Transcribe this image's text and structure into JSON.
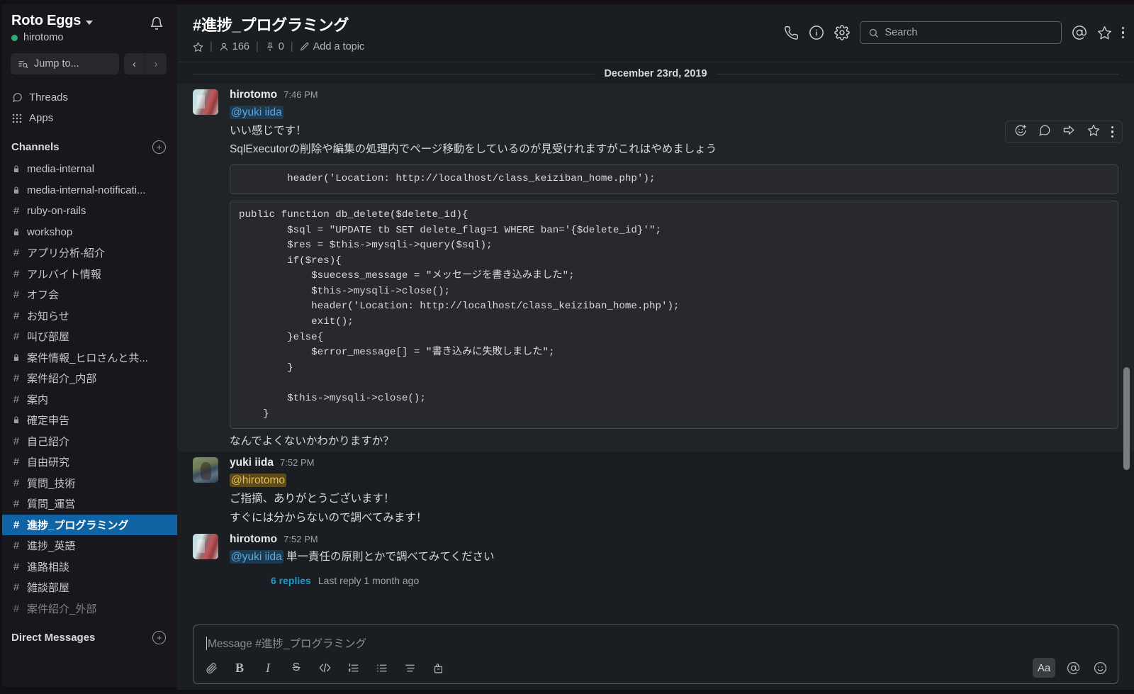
{
  "sidebar": {
    "workspace_name": "Roto Eggs",
    "username": "hirotomo",
    "jump_to_placeholder": "Jump to...",
    "nav_items": [
      {
        "label": "Threads",
        "icon": "threads-icon"
      },
      {
        "label": "Apps",
        "icon": "apps-grid-icon"
      }
    ],
    "channels_heading": "Channels",
    "channels": [
      {
        "name": "media-internal",
        "sym": "lock",
        "state": "normal"
      },
      {
        "name": "media-internal-notificati...",
        "sym": "lock",
        "state": "normal"
      },
      {
        "name": "ruby-on-rails",
        "sym": "hash",
        "state": "normal"
      },
      {
        "name": "workshop",
        "sym": "lock",
        "state": "normal"
      },
      {
        "name": "アプリ分析-紹介",
        "sym": "hash",
        "state": "normal"
      },
      {
        "name": "アルバイト情報",
        "sym": "hash",
        "state": "normal"
      },
      {
        "name": "オフ会",
        "sym": "hash",
        "state": "normal"
      },
      {
        "name": "お知らせ",
        "sym": "hash",
        "state": "normal"
      },
      {
        "name": "叫び部屋",
        "sym": "hash",
        "state": "normal"
      },
      {
        "name": "案件情報_ヒロさんと共...",
        "sym": "lock",
        "state": "normal"
      },
      {
        "name": "案件紹介_内部",
        "sym": "hash",
        "state": "normal"
      },
      {
        "name": "案内",
        "sym": "hash",
        "state": "normal"
      },
      {
        "name": "確定申告",
        "sym": "lock",
        "state": "normal"
      },
      {
        "name": "自己紹介",
        "sym": "hash",
        "state": "normal"
      },
      {
        "name": "自由研究",
        "sym": "hash",
        "state": "normal"
      },
      {
        "name": "質問_技術",
        "sym": "hash",
        "state": "normal"
      },
      {
        "name": "質問_運営",
        "sym": "hash",
        "state": "normal"
      },
      {
        "name": "進捗_プログラミング",
        "sym": "hash",
        "state": "active"
      },
      {
        "name": "進捗_英語",
        "sym": "hash",
        "state": "normal"
      },
      {
        "name": "進路相談",
        "sym": "hash",
        "state": "normal"
      },
      {
        "name": "雑談部屋",
        "sym": "hash",
        "state": "normal"
      },
      {
        "name": "案件紹介_外部",
        "sym": "hash",
        "state": "muted"
      }
    ],
    "dm_heading": "Direct Messages"
  },
  "header": {
    "channel_title": "#進捗_プログラミング",
    "member_count": "166",
    "pin_count": "0",
    "add_topic": "Add a topic",
    "search_placeholder": "Search",
    "icons": [
      "phone-icon",
      "info-icon",
      "gear-icon",
      "mentions-icon",
      "star-icon",
      "kebab-menu-icon"
    ]
  },
  "messages": {
    "date_divider": "December 23rd, 2019",
    "items": [
      {
        "author": "hirotomo",
        "time": "7:46 PM",
        "avatar": "hiro",
        "mention": "@yuki iida",
        "mention_type": "other",
        "lines": [
          "いい感じです！",
          "SqlExecutorの削除や編集の処理内でページ移動をしているのが見受けれますがこれはやめましょう"
        ],
        "code_blocks": [
          "        header('Location: http://localhost/class_keiziban_home.php');",
          "public function db_delete($delete_id){\n        $sql = \"UPDATE tb SET delete_flag=1 WHERE ban='{$delete_id}'\";\n        $res = $this->mysqli->query($sql);\n        if($res){\n            $suecess_message = \"メッセージを書き込みました\";\n            $this->mysqli->close();\n            header('Location: http://localhost/class_keiziban_home.php');\n            exit();\n        }else{\n            $error_message[] = \"書き込みに失敗しました\";\n        }\n\n        $this->mysqli->close();\n    }"
        ],
        "trailing_lines": [
          "なんでよくないかわかりますか？"
        ]
      },
      {
        "author": "yuki iida",
        "time": "7:52 PM",
        "avatar": "yuki",
        "mention": "@hirotomo",
        "mention_type": "self",
        "lines": [
          "ご指摘、ありがとうございます！",
          "すぐには分からないので調べてみます！"
        ],
        "code_blocks": [],
        "trailing_lines": []
      },
      {
        "author": "hirotomo",
        "time": "7:52 PM",
        "avatar": "hiro",
        "mention": "@yuki iida",
        "mention_type": "other",
        "inline_text": " 単一責任の原則とかで調べてみてください",
        "lines": [],
        "code_blocks": [],
        "trailing_lines": [],
        "thread": {
          "replies_label": "6 replies",
          "last_reply": "Last reply 1 month ago"
        }
      }
    ]
  },
  "composer": {
    "placeholder": "Message #進捗_プログラミング",
    "tools_left": [
      "attach-icon",
      "bold-icon",
      "italic-icon",
      "strikethrough-icon",
      "code-icon",
      "ordered-list-icon",
      "bulleted-list-icon",
      "blockquote-icon",
      "snippet-icon"
    ],
    "tools_right": [
      "formatting-aa-icon",
      "mention-icon",
      "emoji-icon"
    ],
    "aa_label": "Aa"
  },
  "colors": {
    "sidebar_bg": "#19171d",
    "main_bg": "#1a1d21",
    "active_channel": "#1164a3",
    "link": "#1d9bd1",
    "mention_self_bg": "#5c4a1f",
    "code_bg": "#27292d"
  }
}
